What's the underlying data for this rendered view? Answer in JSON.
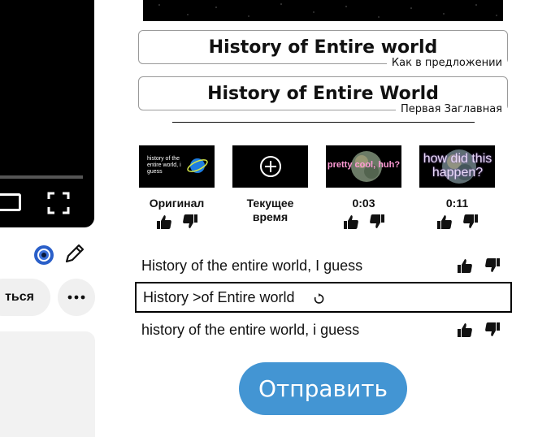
{
  "left": {
    "partial_button_label": "ться"
  },
  "titles": [
    {
      "text": "History of Entire world",
      "caption": "Как в предложении"
    },
    {
      "text": "History of Entire World",
      "caption": "Первая Заглавная"
    }
  ],
  "thumbnails": [
    {
      "label": "Оригинал",
      "thumb_text": "history of the entire world, i guess"
    },
    {
      "label": "Текущее время",
      "thumb_text": ""
    },
    {
      "label": "0:03",
      "thumb_text": "pretty cool, huh?"
    },
    {
      "label": "0:11",
      "thumb_text": "how did this happen?"
    }
  ],
  "suggestions": [
    {
      "text": "History of the entire world, I guess"
    },
    {
      "text": "History >of Entire world"
    },
    {
      "text": "history of the entire world, i guess"
    }
  ],
  "submit_label": "Отправить",
  "colors": {
    "accent": "#4395d3",
    "eye_blue": "#2a5fc9"
  }
}
